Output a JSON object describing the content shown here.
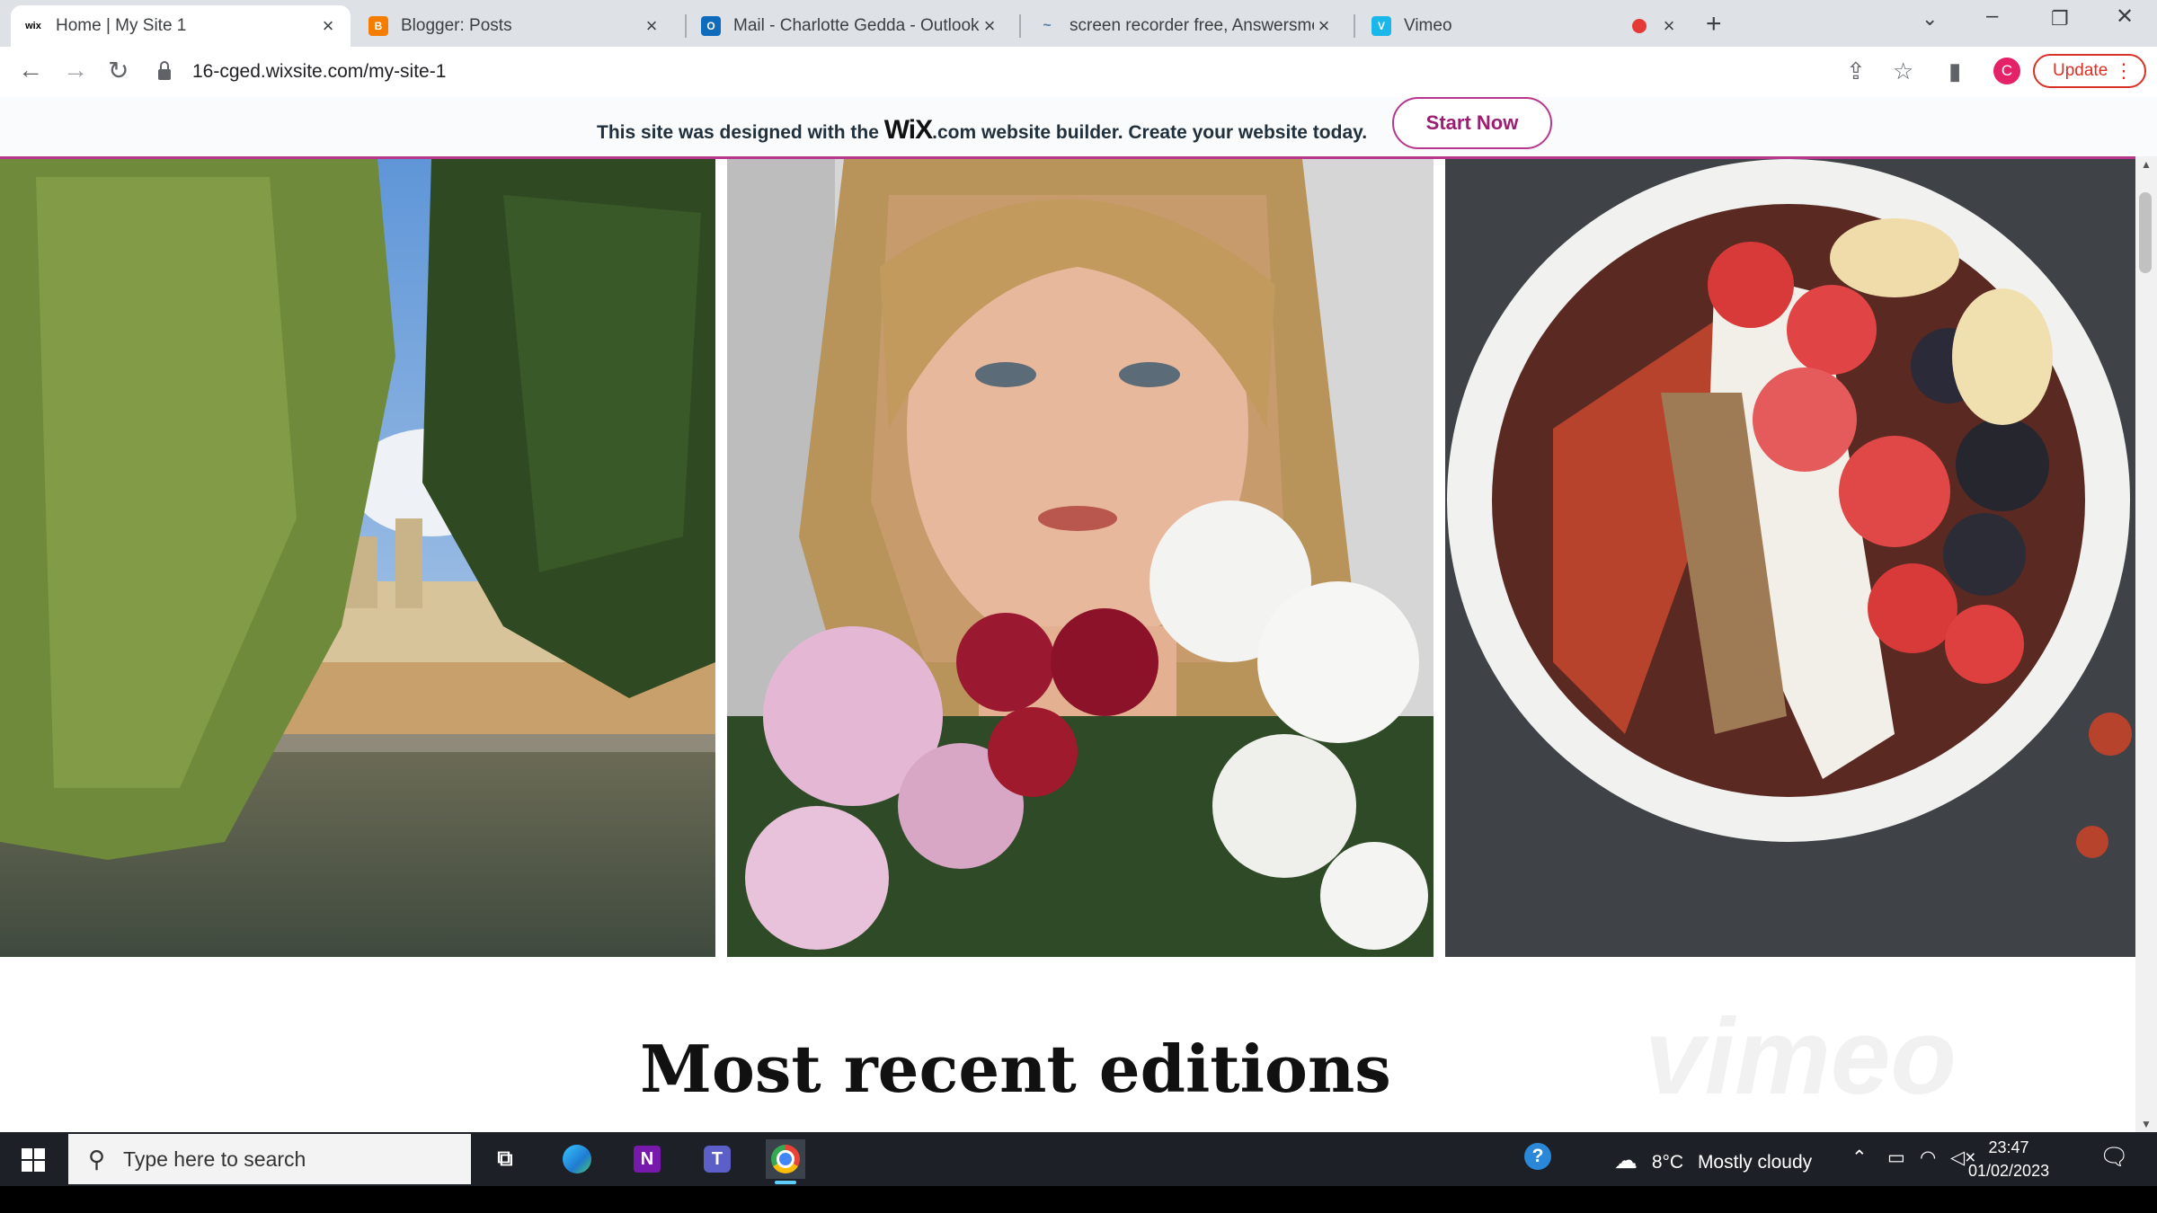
{
  "browser": {
    "tabs": [
      {
        "title": "Home | My Site 1",
        "favicon": "wix-icon",
        "active": true
      },
      {
        "title": "Blogger: Posts",
        "favicon": "blogger-icon",
        "active": false
      },
      {
        "title": "Mail - Charlotte Gedda - Outlook",
        "favicon": "outlook-icon",
        "active": false
      },
      {
        "title": "screen recorder free, Answersme",
        "favicon": "answersmedia-icon",
        "active": false
      },
      {
        "title": "Vimeo",
        "favicon": "vimeo-icon",
        "active": false
      }
    ],
    "url": "16-cged.wixsite.com/my-site-1",
    "profile_initial": "C",
    "update_label": "Update"
  },
  "wix_banner": {
    "text_before": "This site was designed with the",
    "logo": "WiX",
    "logo_suffix": ".com",
    "text_after": "website builder. Create your website today.",
    "button": "Start Now"
  },
  "page": {
    "images": [
      "river-college-photo",
      "portrait-flowers-photo",
      "fruit-bowl-photo"
    ],
    "heading": "Most recent editions",
    "watermark": "vimeo"
  },
  "taskbar": {
    "search_placeholder": "Type here to search",
    "apps": [
      "task-view-icon",
      "edge-icon",
      "onenote-icon",
      "teams-icon",
      "chrome-icon"
    ],
    "weather_temp": "8°C",
    "weather_desc": "Mostly cloudy",
    "time": "23:47",
    "date": "01/02/2023"
  },
  "colors": {
    "wix_accent": "#b7378f",
    "update_red": "#d93025",
    "profile_pink": "#e52168",
    "taskbar": "#1d2127"
  }
}
